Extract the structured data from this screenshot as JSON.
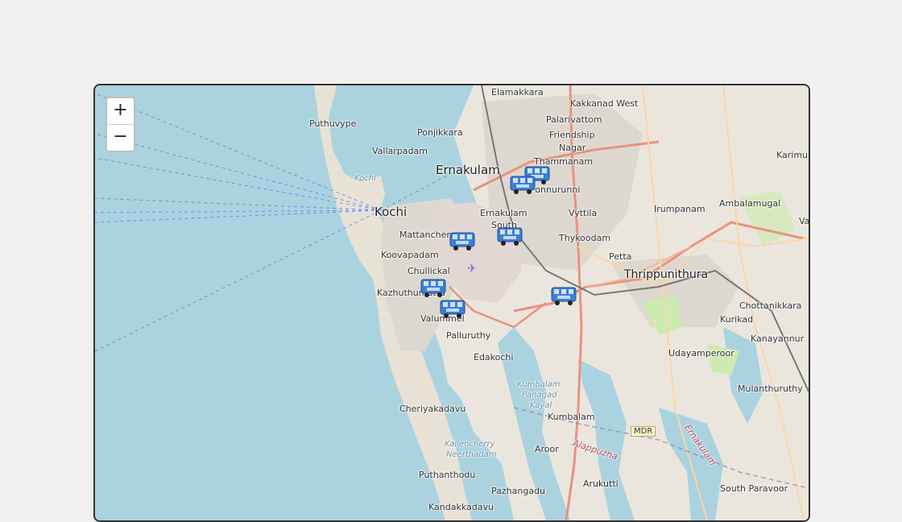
{
  "zoom": {
    "in_label": "+",
    "out_label": "−"
  },
  "places": [
    {
      "name": "Elamakkara"
    },
    {
      "name": "Kakkanad West"
    },
    {
      "name": "Puthuvype"
    },
    {
      "name": "Palarivattom"
    },
    {
      "name": "Ponjikkara"
    },
    {
      "name": "Friendship"
    },
    {
      "name": "Vallarpadam"
    },
    {
      "name": "Nagar"
    },
    {
      "name": "Thammanam"
    },
    {
      "name": "Ernakulam"
    },
    {
      "name": "Ponnurunni"
    },
    {
      "name": "Kochi"
    },
    {
      "name": "Kochi"
    },
    {
      "name": "Ernakulam"
    },
    {
      "name": "South"
    },
    {
      "name": "Vyttila"
    },
    {
      "name": "Irumpanam"
    },
    {
      "name": "Ambalamugal"
    },
    {
      "name": "Mattancherry"
    },
    {
      "name": "Thykoodam"
    },
    {
      "name": "Koovapadam"
    },
    {
      "name": "Petta"
    },
    {
      "name": "Chullickal"
    },
    {
      "name": "Thrippunithura"
    },
    {
      "name": "Kazhuthumuttu"
    },
    {
      "name": "Chottanikkara"
    },
    {
      "name": "Kurikad"
    },
    {
      "name": "Valummel"
    },
    {
      "name": "Palluruthy"
    },
    {
      "name": "Kanayannur"
    },
    {
      "name": "Udayamperoor"
    },
    {
      "name": "Edakochi"
    },
    {
      "name": "Mulanthuruthy"
    },
    {
      "name": "Kumbalam"
    },
    {
      "name": "Panagad"
    },
    {
      "name": "Kayal"
    },
    {
      "name": "Cheriyakadavu"
    },
    {
      "name": "Kumbalam"
    },
    {
      "name": "Aroor"
    },
    {
      "name": "Alappuzha"
    },
    {
      "name": "Ernakulam"
    },
    {
      "name": "Kallencherry"
    },
    {
      "name": "Neerthadam"
    },
    {
      "name": "Puthanthodu"
    },
    {
      "name": "Arukutti"
    },
    {
      "name": "Pazhangadu"
    },
    {
      "name": "South Paravoor"
    },
    {
      "name": "Kandakkadavu"
    },
    {
      "name": "Karimu"
    },
    {
      "name": "Va"
    }
  ],
  "road_shield": "MDR",
  "markers": [
    {
      "name": "bus"
    },
    {
      "name": "bus"
    },
    {
      "name": "bus"
    },
    {
      "name": "bus"
    },
    {
      "name": "bus"
    },
    {
      "name": "bus"
    },
    {
      "name": "bus"
    }
  ],
  "colors": {
    "water": "#aad3df",
    "land": "#eae6de",
    "urban": "#ddd8cf",
    "marker": "#3d7fd6"
  }
}
